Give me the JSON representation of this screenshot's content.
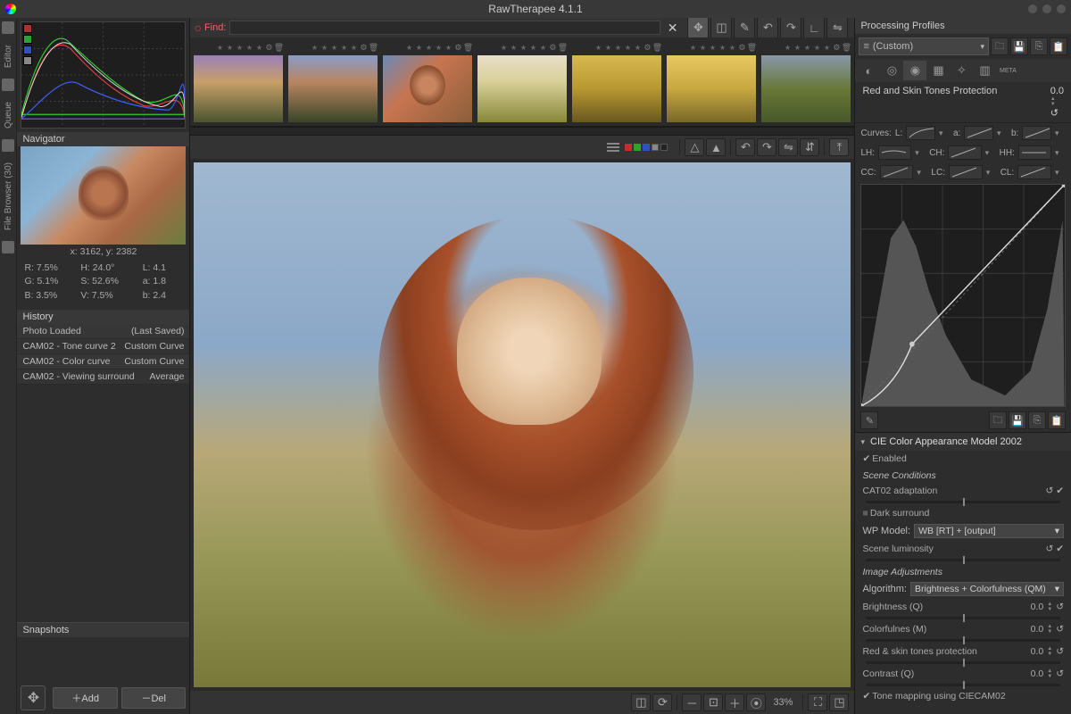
{
  "title": "RawTherapee 4.1.1",
  "rail": {
    "editor": "Editor",
    "queue": "Queue",
    "file_browser": "File Browser (30)"
  },
  "left": {
    "navigator": "Navigator",
    "coords": "x: 3162, y: 2382",
    "rgb": {
      "R": "R:  7.5%",
      "H": "H: 24.0°",
      "L": "L:   4.1",
      "G": "G:  5.1%",
      "S": "S: 52.6%",
      "a": "a:   1.8",
      "B": "B:  3.5%",
      "V": "V:  7.5%",
      "b": "b:   2.4"
    },
    "history": "History",
    "hist": [
      {
        "a": "Photo Loaded",
        "b": "(Last Saved)"
      },
      {
        "a": "CAM02 - Tone curve 2",
        "b": "Custom Curve"
      },
      {
        "a": "CAM02 - Color curve",
        "b": "Custom Curve"
      },
      {
        "a": "CAM02 - Viewing surround",
        "b": "Average"
      }
    ],
    "snapshots": "Snapshots",
    "add": "Add",
    "del": "Del"
  },
  "find": "Find:",
  "zoom": "33%",
  "right": {
    "profiles": "Processing Profiles",
    "profile_sel": "(Custom)",
    "redskin": "Red and Skin Tones Protection",
    "redskin_val": "0.0",
    "curves": "Curves:",
    "c_L": "L:",
    "c_a": "a:",
    "c_b": "b:",
    "c_LH": "LH:",
    "c_CH": "CH:",
    "c_HH": "HH:",
    "c_CC": "CC:",
    "c_LC": "LC:",
    "c_CL": "CL:",
    "ciecam": "CIE Color Appearance Model 2002",
    "enabled": "Enabled",
    "scene_cond": "Scene Conditions",
    "cat02": "CAT02 adaptation",
    "dark_surround": "Dark surround",
    "wp_model_lbl": "WP Model:",
    "wp_model": "WB [RT] + [output]",
    "scene_lum": "Scene luminosity",
    "img_adj": "Image Adjustments",
    "algo_lbl": "Algorithm:",
    "algo": "Brightness + Colorfulness (QM)",
    "brightness": "Brightness (Q)",
    "brightness_v": "0.0",
    "colorful": "Colorfulnes (M)",
    "colorful_v": "0.0",
    "redskin2": "Red & skin tones protection",
    "redskin2_v": "0.0",
    "contrast": "Contrast (Q)",
    "contrast_v": "0.0",
    "tonemap": "Tone mapping using CIECAM02"
  }
}
